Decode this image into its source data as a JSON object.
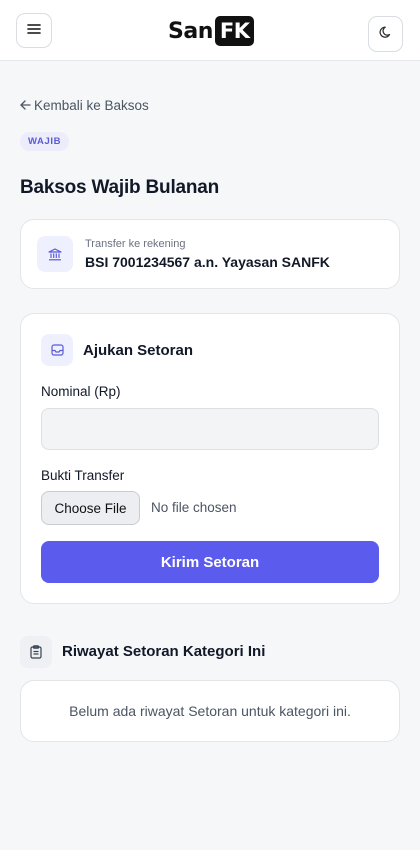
{
  "header": {
    "logo_left": "San",
    "logo_right": "FK",
    "menu_icon": "hamburger-icon",
    "theme_icon": "moon-icon"
  },
  "back": {
    "label": "Kembali ke Baksos"
  },
  "badge": {
    "label": "WAJIB"
  },
  "page": {
    "title": "Baksos Wajib Bulanan"
  },
  "bank": {
    "icon": "bank-icon",
    "caption": "Transfer ke rekening",
    "account": "BSI 7001234567 a.n. Yayasan SANFK"
  },
  "form": {
    "icon": "inbox-icon",
    "title": "Ajukan Setoran",
    "nominal_label": "Nominal (Rp)",
    "nominal_value": "",
    "bukti_label": "Bukti Transfer",
    "file_button": "Choose File",
    "file_status": "No file chosen",
    "submit_label": "Kirim Setoran"
  },
  "history": {
    "icon": "clipboard-icon",
    "title": "Riwayat Setoran Kategori Ini",
    "empty_text": "Belum ada riwayat Setoran untuk kategori ini."
  },
  "colors": {
    "accent": "#5b5bee",
    "badge_bg": "#ececfb",
    "badge_text": "#5b5bd6",
    "page_bg": "#f6f7f9"
  }
}
